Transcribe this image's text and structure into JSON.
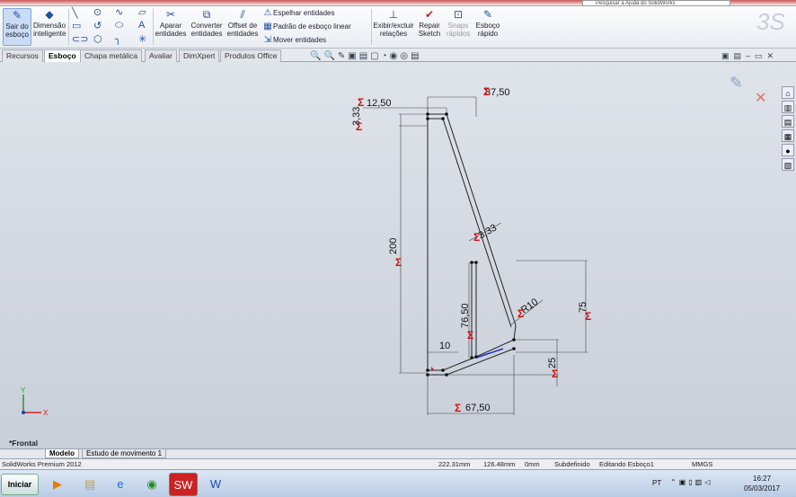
{
  "window": {
    "help_search_placeholder": "Pesquisar a Ajuda do SolidWorks"
  },
  "ribbon": {
    "exit_sketch": "Sair do esboço",
    "smart_dimension": "Dimensão inteligente",
    "trim": "Aparar entidades",
    "convert": "Converter entidades",
    "offset": "Offset de entidades",
    "mirror": "Espelhar entidades",
    "linear_pattern": "Padrão de esboço linear",
    "move": "Mover entidades",
    "display_relations": "Exibir/excluir relações",
    "repair": "Repair Sketch",
    "snaps": "Snaps rápidos",
    "rapid_sketch": "Esboço rápido"
  },
  "tabs": [
    "Recursos",
    "Esboço",
    "Chapa metálica",
    "Avaliar",
    "DimXpert",
    "Produtos Office"
  ],
  "active_tab": "Esboço",
  "viewport": {
    "view_name": "*Frontal",
    "dimensions": {
      "d1": "37,50",
      "d2": "12,50",
      "d3": "3,33",
      "d4": "200",
      "d5": "3,33",
      "d6": "R10",
      "d7": "75",
      "d8": "76,50",
      "d9": "10",
      "d10": "25",
      "d11": "67,50"
    },
    "axis_x": "X",
    "axis_y": "Y"
  },
  "bottom_tabs": [
    "Modelo",
    "Estudo de movimento 1"
  ],
  "status": {
    "app": "SolidWorks Premium 2012",
    "x": "222.31mm",
    "y": "126.48mm",
    "z": "0mm",
    "state": "Subdefinido",
    "editing": "Editando Esboço1",
    "units": "MMGS"
  },
  "taskbar": {
    "start": "Iniciar",
    "lang": "PT",
    "time": "16:27",
    "date": "05/03/2017"
  }
}
